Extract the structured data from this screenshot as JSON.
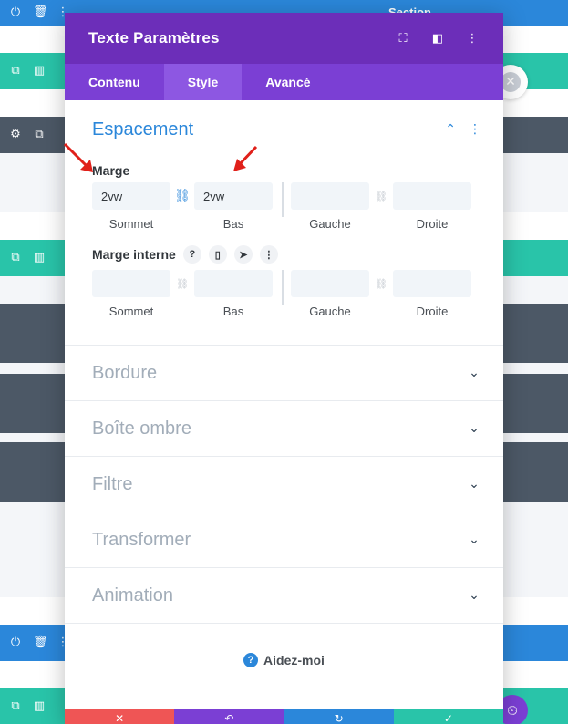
{
  "background": {
    "section_label": "Section",
    "toolbar_icons": [
      "power-icon",
      "trash-icon",
      "more-icon"
    ],
    "row_icons": [
      "duplicate-icon",
      "columns-icon"
    ],
    "settings_icons": [
      "gear-icon",
      "duplicate-icon"
    ]
  },
  "modal": {
    "title": "Texte Paramètres",
    "header_icons": [
      "fullscreen-icon",
      "sidebar-icon",
      "more-icon"
    ],
    "tabs": [
      {
        "label": "Contenu",
        "active": false
      },
      {
        "label": "Style",
        "active": true
      },
      {
        "label": "Avancé",
        "active": false
      }
    ],
    "spacing": {
      "title": "Espacement",
      "margin": {
        "label": "Marge",
        "top": "2vw",
        "bottom": "2vw",
        "left": "",
        "right": "",
        "captions": [
          "Sommet",
          "Bas",
          "Gauche",
          "Droite"
        ]
      },
      "padding": {
        "label": "Marge interne",
        "top": "",
        "bottom": "",
        "left": "",
        "right": "",
        "captions": [
          "Sommet",
          "Bas",
          "Gauche",
          "Droite"
        ]
      }
    },
    "sections": [
      {
        "title": "Bordure"
      },
      {
        "title": "Boîte ombre"
      },
      {
        "title": "Filtre"
      },
      {
        "title": "Transformer"
      },
      {
        "title": "Animation"
      }
    ],
    "help_label": "Aidez-moi"
  },
  "colors": {
    "header_purple": "#6c2eb9",
    "tab_purple": "#7b3fd4",
    "accent_blue": "#2b87da",
    "teal": "#29c4a9",
    "slate": "#4c5866",
    "footer_red": "#ef5555",
    "footer_purple": "#7b3fd4",
    "footer_blue": "#2b87da",
    "footer_teal": "#29c4a9",
    "annotation_red": "#e0201a"
  }
}
